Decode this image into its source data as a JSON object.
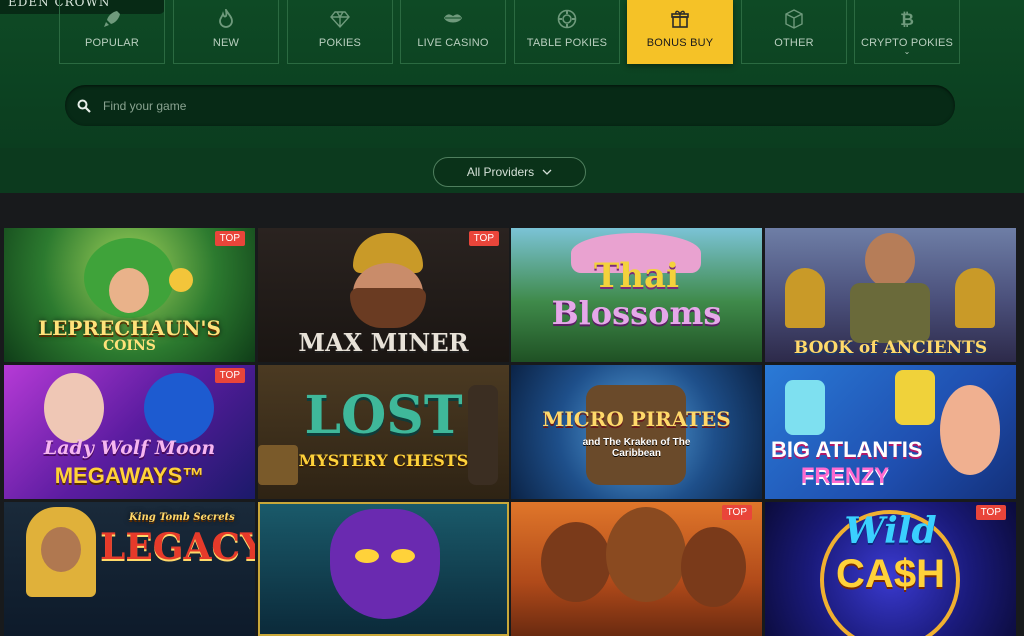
{
  "logo": {
    "text": "EDEN CROWN"
  },
  "categories": [
    {
      "label": "POPULAR",
      "icon": "rocket-icon"
    },
    {
      "label": "NEW",
      "icon": "flame-icon"
    },
    {
      "label": "POKIES",
      "icon": "diamond-icon"
    },
    {
      "label": "LIVE CASINO",
      "icon": "lips-icon"
    },
    {
      "label": "TABLE POKIES",
      "icon": "chip-icon"
    },
    {
      "label": "BONUS BUY",
      "icon": "gift-icon",
      "active": true
    },
    {
      "label": "OTHER",
      "icon": "cube-icon"
    },
    {
      "label": "CRYPTO POKIES",
      "icon": "bitcoin-icon"
    }
  ],
  "search": {
    "placeholder": "Find your game",
    "value": ""
  },
  "providers": {
    "label": "All Providers"
  },
  "badge_label": "TOP",
  "games": [
    {
      "title": "LEPRECHAUN'S",
      "subtitle": "COINS",
      "top": true
    },
    {
      "title": "MAX MINER",
      "subtitle": "",
      "top": true
    },
    {
      "title": "Thai",
      "subtitle": "Blossoms",
      "top": false
    },
    {
      "title": "BOOK of ANCIENTS",
      "subtitle": "",
      "top": false
    },
    {
      "title": "Lady Wolf Moon",
      "subtitle": "MEGAWAYS™",
      "top": true
    },
    {
      "title": "LOST",
      "subtitle": "MYSTERY CHESTS",
      "top": false
    },
    {
      "title": "MICRO PIRATES",
      "subtitle": "and The Kraken of The Caribbean",
      "top": false
    },
    {
      "title": "BIG ATLANTIS",
      "subtitle": "FRENZY",
      "top": false
    },
    {
      "title": "King Tomb Secrets",
      "subtitle": "LEGACY",
      "top": false
    },
    {
      "title": "",
      "subtitle": "",
      "top": false
    },
    {
      "title": "",
      "subtitle": "",
      "top": true
    },
    {
      "title": "Wild",
      "subtitle": "CA$H",
      "top": true
    }
  ],
  "colors": {
    "accent": "#f5c227",
    "badge": "#e9453a",
    "header": "#0e4a25"
  }
}
